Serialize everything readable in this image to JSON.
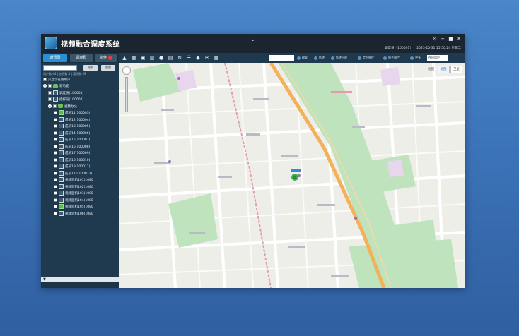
{
  "app": {
    "title": "视频融合调度系统",
    "collapse_icon": "chevron-down-icon",
    "user_status": "调度员（100001）",
    "datetime": "2023-10-31 15:50:24 星期二"
  },
  "left_panel": {
    "tabs": [
      {
        "label": "通讯录"
      },
      {
        "label": "调度群"
      },
      {
        "label": "协作"
      }
    ],
    "search": {
      "placeholder": "",
      "search_label": "搜索",
      "reset_label": "重置"
    },
    "stats": "用户数:44 | 在线数:5 | 离线数:39",
    "only_online_label": "只显示在线用户",
    "tree": [
      {
        "label": "新功能",
        "level": 0,
        "type": "group"
      },
      {
        "label": "调度员(100001)",
        "level": 1,
        "type": "device"
      },
      {
        "label": "指挥员(100002)",
        "level": 1,
        "type": "device"
      },
      {
        "label": "视频办公",
        "level": 1,
        "type": "group"
      },
      {
        "label": "成员11(100003)",
        "level": 2,
        "type": "device",
        "online": true
      },
      {
        "label": "成员12(100004)",
        "level": 2,
        "type": "device"
      },
      {
        "label": "成员13(100005)",
        "level": 2,
        "type": "device"
      },
      {
        "label": "成员14(100006)",
        "level": 2,
        "type": "device"
      },
      {
        "label": "成员15(100007)",
        "level": 2,
        "type": "device"
      },
      {
        "label": "成员16(100008)",
        "level": 2,
        "type": "device"
      },
      {
        "label": "成员17(100009)",
        "level": 2,
        "type": "device"
      },
      {
        "label": "成员18(100010)",
        "level": 2,
        "type": "device"
      },
      {
        "label": "成员19(100011)",
        "level": 2,
        "type": "device"
      },
      {
        "label": "成员110(100012)",
        "level": 2,
        "type": "device"
      },
      {
        "label": "视频监机101(1080",
        "level": 2,
        "type": "device"
      },
      {
        "label": "视频监机102(1080",
        "level": 2,
        "type": "device"
      },
      {
        "label": "视频监机103(1080",
        "level": 2,
        "type": "device"
      },
      {
        "label": "视频监机104(1080",
        "level": 2,
        "type": "device"
      },
      {
        "label": "视频监机105(1080",
        "level": 2,
        "type": "device",
        "online": true
      },
      {
        "label": "视频监机106(1080",
        "level": 2,
        "type": "device"
      }
    ]
  },
  "toolbar": {
    "search_label": "搜索",
    "buttons": [
      "轨迹",
      "轨迹回放",
      "定时围栏",
      "电子围栏",
      "更多"
    ],
    "select_value": "在线用户"
  },
  "map": {
    "type_labels": [
      "地图",
      "卫星"
    ],
    "active_type": "地图",
    "marker_label": "成员11"
  },
  "colors": {
    "titlebar": "#1b2530",
    "panel": "#1f3a4f",
    "accent": "#2a8fd3",
    "park": "#bfe3bd",
    "road_main": "#f2b15a",
    "rail": "#e49bab"
  }
}
